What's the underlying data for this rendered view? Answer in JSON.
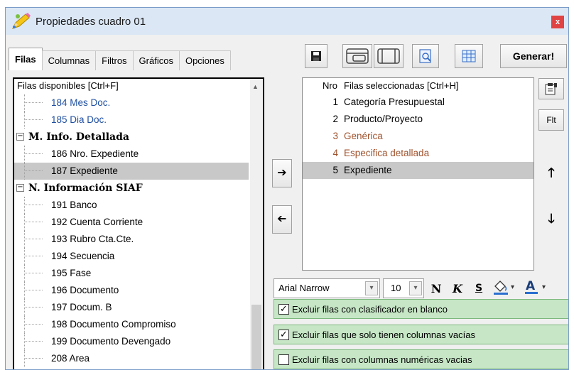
{
  "window": {
    "title": "Propiedades cuadro 01",
    "close_label": "x"
  },
  "tabs": [
    {
      "label": "Filas",
      "active": true
    },
    {
      "label": "Columnas"
    },
    {
      "label": "Filtros"
    },
    {
      "label": "Gráficos"
    },
    {
      "label": "Opciones"
    }
  ],
  "toolbar": {
    "generar_label": "Generar!"
  },
  "available": {
    "header": "Filas disponibles     [Ctrl+F]",
    "items": [
      {
        "type": "leaf",
        "label": "184 Mes Doc.",
        "color": "blue"
      },
      {
        "type": "leaf",
        "label": "185 Dia Doc.",
        "color": "blue"
      },
      {
        "type": "group",
        "label": "M. Info. Detallada"
      },
      {
        "type": "leaf",
        "label": "186 Nro. Expediente"
      },
      {
        "type": "leaf",
        "label": "187 Expediente",
        "selected": true
      },
      {
        "type": "group",
        "label": "N. Información SIAF"
      },
      {
        "type": "leaf",
        "label": "191 Banco"
      },
      {
        "type": "leaf",
        "label": "192 Cuenta Corriente"
      },
      {
        "type": "leaf",
        "label": "193 Rubro Cta.Cte."
      },
      {
        "type": "leaf",
        "label": "194 Secuencia"
      },
      {
        "type": "leaf",
        "label": "195 Fase"
      },
      {
        "type": "leaf",
        "label": "196 Documento"
      },
      {
        "type": "leaf",
        "label": "197 Docum. B"
      },
      {
        "type": "leaf",
        "label": "198 Documento Compromiso"
      },
      {
        "type": "leaf",
        "label": "199 Documento Devengado"
      },
      {
        "type": "leaf",
        "label": "208 Area"
      }
    ]
  },
  "selected": {
    "header_nro": "Nro",
    "header_label": "Filas seleccionadas     [Ctrl+H]",
    "rows": [
      {
        "nro": "1",
        "label": "Categoría Presupuestal"
      },
      {
        "nro": "2",
        "label": "Producto/Proyecto"
      },
      {
        "nro": "3",
        "label": "Genérica",
        "color": "brown"
      },
      {
        "nro": "4",
        "label": "Especifica detallada",
        "color": "brown"
      },
      {
        "nro": "5",
        "label": "Expediente",
        "selected": true
      }
    ]
  },
  "side": {
    "flt_label": "Flt"
  },
  "format": {
    "font": "Arial Narrow",
    "size": "10",
    "bold": "N",
    "italic": "K",
    "strike": "S"
  },
  "options": [
    {
      "label": "Excluir filas con clasificador en blanco",
      "checked": true
    },
    {
      "label": "Excluir filas que solo tienen columnas vacías",
      "checked": true
    },
    {
      "label": "Excluir filas con columnas numéricas vacias",
      "checked": false
    }
  ],
  "colors": {
    "blue_text": "#1f4fa0",
    "brown_text": "#a0522d",
    "selection": "#c8c8c8",
    "green_option": "#c6e6c6"
  }
}
